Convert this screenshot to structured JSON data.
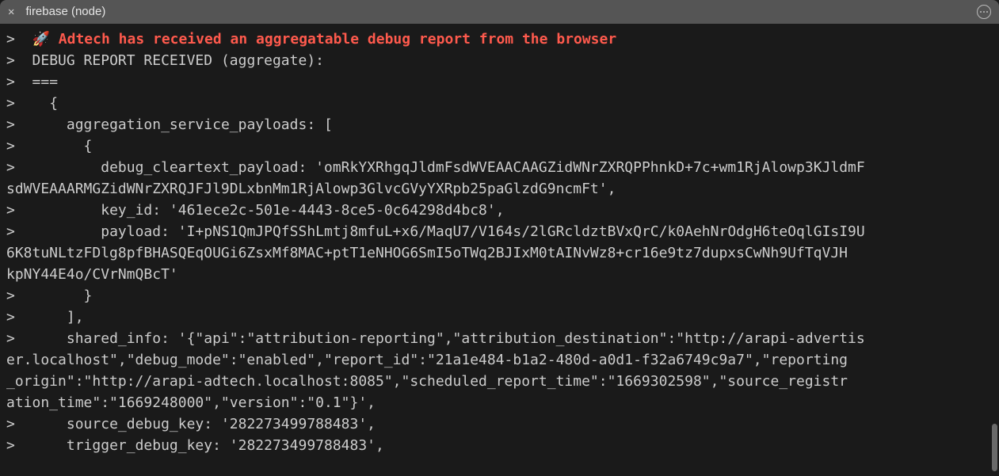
{
  "tab": {
    "title": "firebase (node)"
  },
  "prompt": ">",
  "space": "  ",
  "lines": {
    "l0_icon": "🚀 ",
    "l0": "Adtech has received an aggregatable debug report from the browser",
    "l1": "DEBUG REPORT RECEIVED (aggregate):",
    "l2": "===",
    "l3": "  {",
    "l4": "    aggregation_service_payloads: [",
    "l5": "      {",
    "l6a": "        debug_cleartext_payload: 'omRkYXRhgqJldmFsdWVEAACAAGZidWNrZXRQPPhnkD+7c+wm1RjAlowp3KJldmF",
    "l6b": "sdWVEAAARMGZidWNrZXRQJFJl9DLxbnMm1RjAlowp3GlvcGVyYXRpb25paGlzdG9ncmFt',",
    "l7": "        key_id: '461ece2c-501e-4443-8ce5-0c64298d4bc8',",
    "l8a": "        payload: 'I+pNS1QmJPQfSShLmtj8mfuL+x6/MaqU7/V164s/2lGRcldztBVxQrC/k0AehNrOdgH6teOqlGIsI9U",
    "l8b": "6K8tuNLtzFDlg8pfBHASQEqOUGi6ZsxMf8MAC+ptT1eNHOG6SmI5oTWq2BJIxM0tAINvWz8+cr16e9tz7dupxsCwNh9UfTqVJH",
    "l8c": "kpNY44E4o/CVrNmQBcT'",
    "l9": "      }",
    "l10": "    ],",
    "l11a": "    shared_info: '{\"api\":\"attribution-reporting\",\"attribution_destination\":\"http://arapi-advertis",
    "l11b": "er.localhost\",\"debug_mode\":\"enabled\",\"report_id\":\"21a1e484-b1a2-480d-a0d1-f32a6749c9a7\",\"reporting",
    "l11c": "_origin\":\"http://arapi-adtech.localhost:8085\",\"scheduled_report_time\":\"1669302598\",\"source_registr",
    "l11d": "ation_time\":\"1669248000\",\"version\":\"0.1\"}',",
    "l12": "    source_debug_key: '282273499788483',",
    "l13": "    trigger_debug_key: '282273499788483',"
  }
}
